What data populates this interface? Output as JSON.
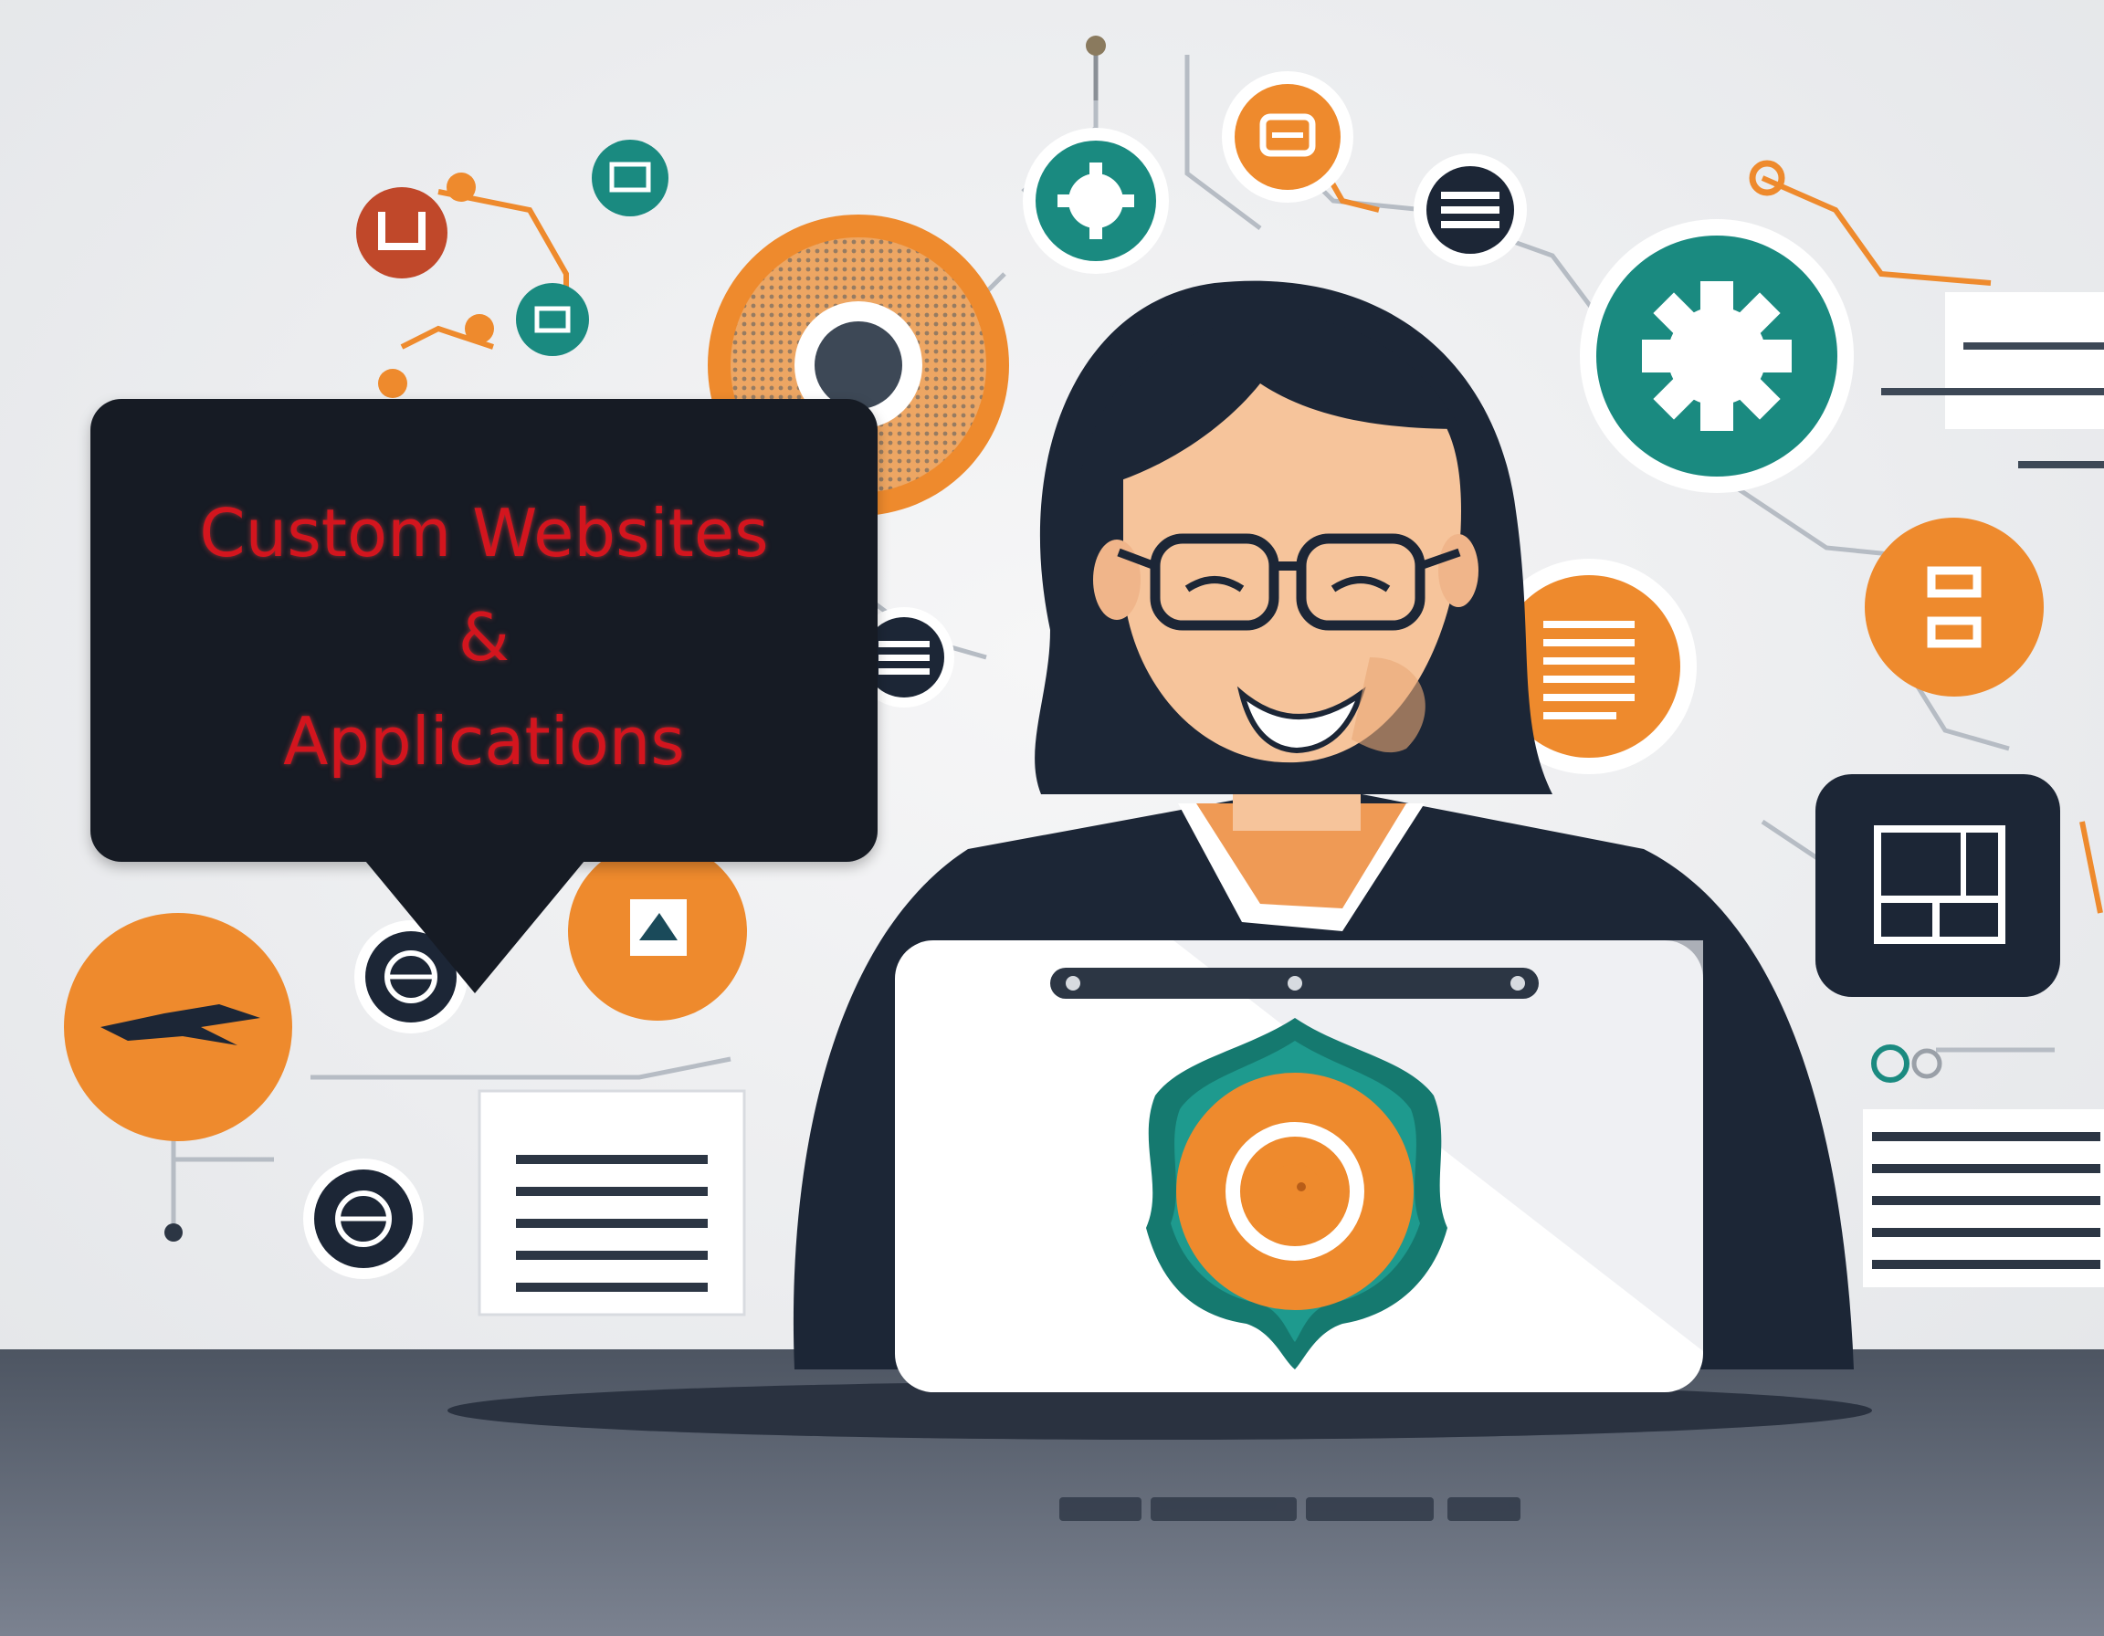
{
  "banner": {
    "lines": [
      "Custom Websites",
      "&",
      "Applications"
    ],
    "text_color": "#d3151e",
    "bubble_color": "#161b24"
  },
  "palette": {
    "orange": "#ee8a2d",
    "teal": "#1a8a80",
    "navy": "#1c2636",
    "background": "#eeeff1",
    "desk": "#5c6470"
  },
  "illustration": {
    "subject": "smiling woman with glasses working at a laptop",
    "icons": [
      "gear-icon",
      "document-icon",
      "layout-icon",
      "target-icon",
      "network-icon"
    ]
  }
}
